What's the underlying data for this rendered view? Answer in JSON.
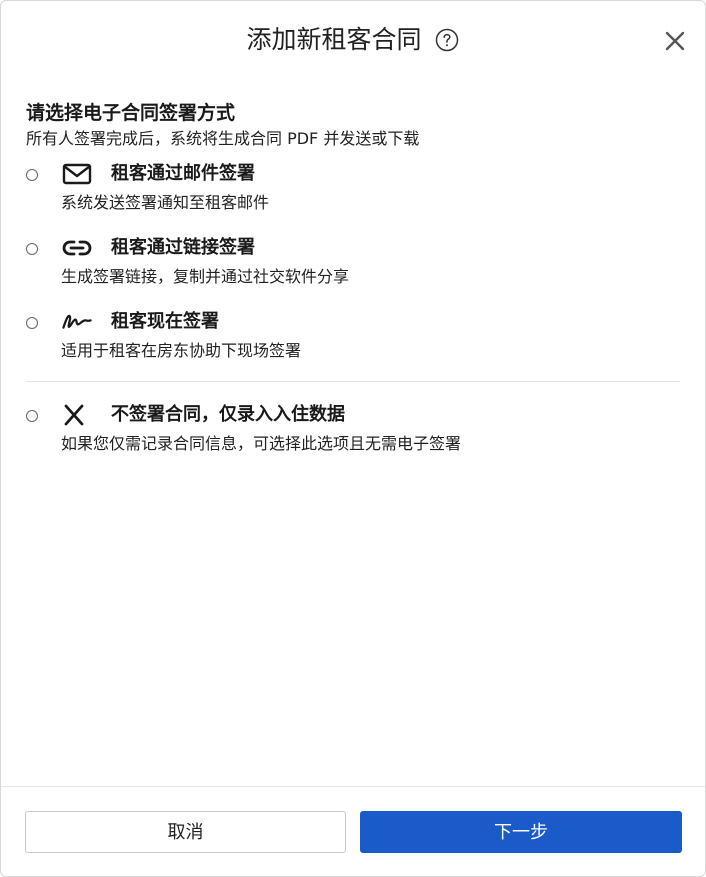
{
  "dialog": {
    "title": "添加新租客合同",
    "help_icon": "help-circle-icon",
    "close_icon": "close-icon"
  },
  "section": {
    "title": "请选择电子合同签署方式",
    "description": "所有人签署完成后，系统将生成合同 PDF 并发送或下载"
  },
  "options": [
    {
      "icon": "mail-icon",
      "label": "租客通过邮件签署",
      "description": "系统发送签署通知至租客邮件",
      "selected": false
    },
    {
      "icon": "link-icon",
      "label": "租客通过链接签署",
      "description": "生成签署链接，复制并通过社交软件分享",
      "selected": false
    },
    {
      "icon": "signature-icon",
      "label": "租客现在签署",
      "description": "适用于租客在房东协助下现场签署",
      "selected": false
    },
    {
      "icon": "x-icon",
      "label": "不签署合同，仅录入入住数据",
      "description": "如果您仅需记录合同信息，可选择此选项且无需电子签署",
      "selected": false
    }
  ],
  "footer": {
    "cancel_label": "取消",
    "next_label": "下一步"
  },
  "colors": {
    "primary": "#1a5bc9",
    "border": "#c8c8c8",
    "divider": "#e3e3e3"
  }
}
